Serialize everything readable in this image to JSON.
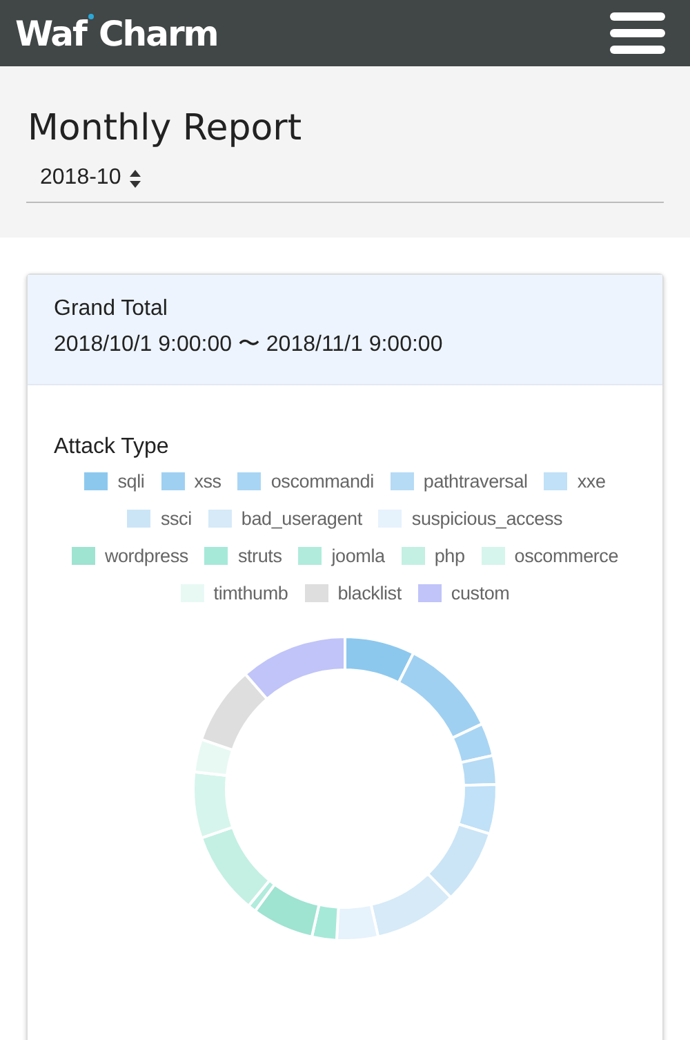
{
  "header": {
    "logo": "Waf Charm"
  },
  "page": {
    "title": "Monthly Report",
    "month_select": {
      "value": "2018-10"
    }
  },
  "card": {
    "title": "Grand Total",
    "period": "2018/10/1 9:00:00 〜 2018/11/1 9:00:00",
    "attack_type": {
      "title": "Attack Type",
      "legend": [
        {
          "label": "sqli",
          "color": "#8cc8ee"
        },
        {
          "label": "xss",
          "color": "#9fd0f2"
        },
        {
          "label": "oscommandi",
          "color": "#a9d5f4"
        },
        {
          "label": "pathtraversal",
          "color": "#b5dbf5"
        },
        {
          "label": "xxe",
          "color": "#c0e1f7"
        },
        {
          "label": "ssci",
          "color": "#cbe5f7"
        },
        {
          "label": "bad_useragent",
          "color": "#d6eaf8"
        },
        {
          "label": "suspicious_access",
          "color": "#e6f2fc"
        },
        {
          "label": "wordpress",
          "color": "#9fe3d1"
        },
        {
          "label": "struts",
          "color": "#a6e9d9"
        },
        {
          "label": "joomla",
          "color": "#b0ebdc"
        },
        {
          "label": "php",
          "color": "#c3f0e3"
        },
        {
          "label": "oscommerce",
          "color": "#d6f5ec"
        },
        {
          "label": "timthumb",
          "color": "#e8f9f4"
        },
        {
          "label": "blacklist",
          "color": "#dedede"
        },
        {
          "label": "custom",
          "color": "#c0c4f8"
        }
      ]
    }
  }
}
